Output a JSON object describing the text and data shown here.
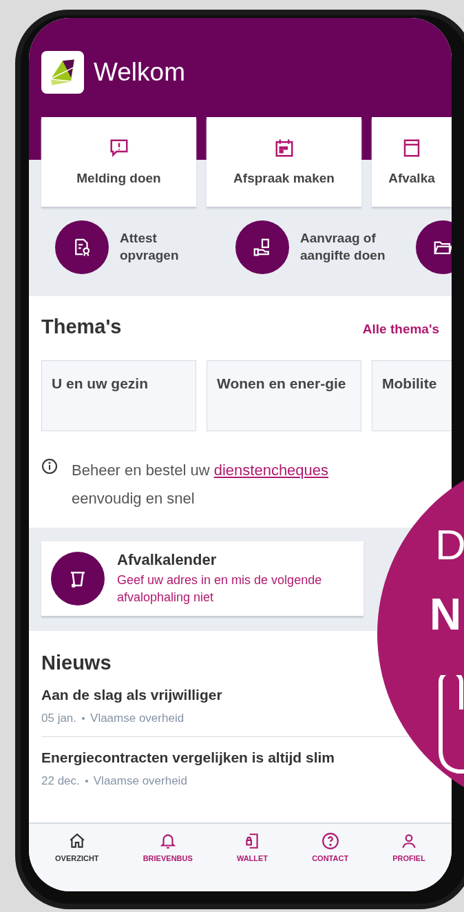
{
  "header": {
    "title": "Welkom"
  },
  "quick_tiles": [
    {
      "label": "Melding doen"
    },
    {
      "label": "Afspraak maken"
    },
    {
      "label": "Afvalka"
    }
  ],
  "quick_links": [
    {
      "kind": "labeled",
      "label": "Attest opvragen"
    },
    {
      "kind": "labeled",
      "label": "Aanvraag of aangifte doen"
    },
    {
      "kind": "icon_only"
    }
  ],
  "themes": {
    "title": "Thema's",
    "link": "Alle thema's",
    "items": [
      {
        "label": "U en uw gezin"
      },
      {
        "label": "Wonen en ener-gie"
      },
      {
        "label": "Mobilite"
      }
    ]
  },
  "info": {
    "text_before": "Beheer en bestel uw",
    "link": "dienstencheques",
    "text_after": "eenvoudig en snel"
  },
  "promo_card": {
    "title": "Afvalkalender",
    "subtitle": "Geef uw adres in en mis de volgende afvalophaling niet"
  },
  "news": {
    "title": "Nieuws",
    "items": [
      {
        "title": "Aan de slag als vrijwilliger",
        "date": "05 jan.",
        "source": "Vlaamse overheid"
      },
      {
        "title": "Energiecontracten vergelijken is altijd slim",
        "date": "22 dec.",
        "source": "Vlaamse overheid"
      }
    ]
  },
  "tab_bar": [
    {
      "label": "OVERZICHT",
      "selected": true
    },
    {
      "label": "BRIEVENBUS",
      "selected": false
    },
    {
      "label": "WALLET",
      "selected": false
    },
    {
      "label": "CONTACT",
      "selected": false
    },
    {
      "label": "PROFIEL",
      "selected": false
    }
  ],
  "overlay_badge": {
    "line_1": "D",
    "line_2": "N"
  }
}
